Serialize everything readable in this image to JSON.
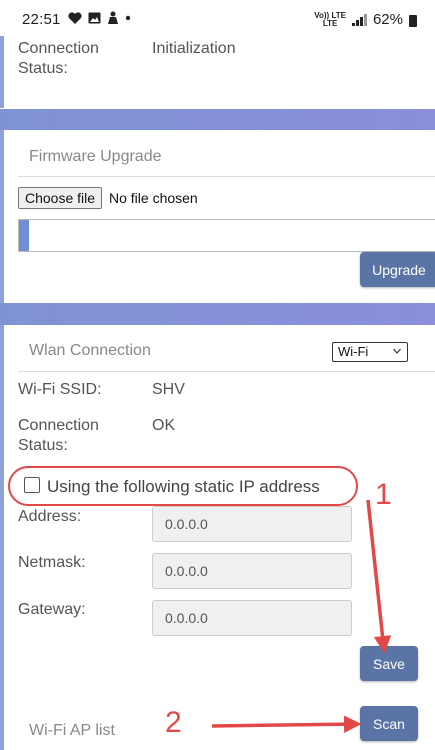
{
  "status_bar": {
    "time": "22:51",
    "left_icons": [
      "heart-icon",
      "image-icon",
      "person-icon",
      "dot-icon"
    ],
    "network_top": "Vo)) LTE",
    "network_bottom": "LTE",
    "battery": "62%"
  },
  "top_status": {
    "label": "Connection Status:",
    "value": "Initialization"
  },
  "firmware": {
    "title": "Firmware Upgrade",
    "choose_file": "Choose file",
    "no_file": "No file chosen",
    "progress": 0.025,
    "upgrade_label": "Upgrade"
  },
  "wlan": {
    "title": "Wlan Connection",
    "mode_selected": "Wi-Fi",
    "ssid_label": "Wi-Fi SSID:",
    "ssid_value": "SHV",
    "conn_label": "Connection Status:",
    "conn_value": "OK",
    "static_ip_label": "Using the following static IP address",
    "static_ip_checked": false,
    "address_label": "Address:",
    "address_value": "0.0.0.0",
    "netmask_label": "Netmask:",
    "netmask_value": "0.0.0.0",
    "gateway_label": "Gateway:",
    "gateway_value": "0.0.0.0",
    "save_label": "Save"
  },
  "ap_list": {
    "title": "Wi-Fi AP list",
    "scan_label": "Scan"
  },
  "annotations": {
    "one": "1",
    "two": "2"
  },
  "colors": {
    "accent": "#7f93d4",
    "button": "#5b74a6",
    "annotation": "#e34848"
  }
}
